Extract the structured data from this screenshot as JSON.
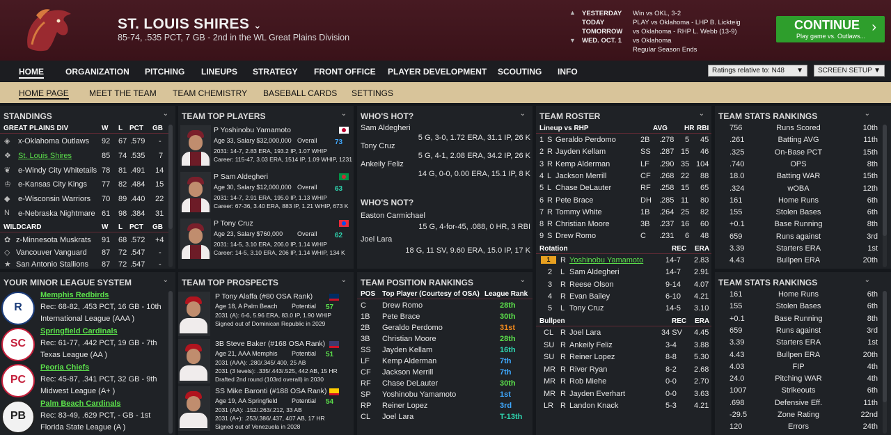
{
  "header": {
    "title": "ST. LOUIS SHIRES",
    "subtitle": "85-74, .535 PCT, 7 GB - 2nd in the WL Great Plains Division",
    "schedule": [
      {
        "day": "YESTERDAY",
        "info": "Win vs OKL, 3-2"
      },
      {
        "day": "TODAY",
        "info": "PLAY vs Oklahoma - LHP B. Lickteig"
      },
      {
        "day": "TOMORROW",
        "info": "vs Oklahoma - RHP L. Webb (13-9)"
      },
      {
        "day": "WED. OCT. 1",
        "info": "vs Oklahoma"
      },
      {
        "day": "",
        "info": "Regular Season Ends"
      }
    ],
    "continue_label": "CONTINUE",
    "continue_sub": "Play game vs. Outlaws..."
  },
  "nav": {
    "main": [
      "HOME",
      "ORGANIZATION",
      "PITCHING",
      "LINEUPS",
      "STRATEGY",
      "FRONT OFFICE",
      "PLAYER DEVELOPMENT",
      "SCOUTING",
      "INFO"
    ],
    "ratings_select": "Ratings relative to: N48",
    "screen_setup": "SCREEN SETUP",
    "sub": [
      "HOME PAGE",
      "MEET THE TEAM",
      "TEAM CHEMISTRY",
      "BASEBALL CARDS",
      "SETTINGS"
    ]
  },
  "standings": {
    "title": "STANDINGS",
    "div_header": [
      "GREAT PLAINS DIV",
      "W",
      "L",
      "PCT",
      "GB"
    ],
    "div": [
      [
        "x-Oklahoma Outlaws",
        "92",
        "67",
        ".579",
        "-"
      ],
      [
        "St. Louis Shires",
        "85",
        "74",
        ".535",
        "7"
      ],
      [
        "e-Windy City Whitetails",
        "78",
        "81",
        ".491",
        "14"
      ],
      [
        "e-Kansas City Kings",
        "77",
        "82",
        ".484",
        "15"
      ],
      [
        "e-Wisconsin Warriors",
        "70",
        "89",
        ".440",
        "22"
      ],
      [
        "e-Nebraska Nightmare",
        "61",
        "98",
        ".384",
        "31"
      ]
    ],
    "wc_header": [
      "WILDCARD",
      "W",
      "L",
      "PCT",
      "GB"
    ],
    "wc": [
      [
        "z-Minnesota Muskrats",
        "91",
        "68",
        ".572",
        "+4"
      ],
      [
        "Vancouver Vanguard",
        "87",
        "72",
        ".547",
        "-"
      ],
      [
        "San Antonio Stallions",
        "87",
        "72",
        ".547",
        "-"
      ]
    ]
  },
  "minor": {
    "title": "YOUR MINOR LEAGUE SYSTEM",
    "teams": [
      {
        "name": "Memphis Redbirds",
        "rec": "Rec: 68-82, .453 PCT, 16 GB - 10th",
        "league": "International League (AAA )"
      },
      {
        "name": "Springfield Cardinals",
        "rec": "Rec: 61-77, .442 PCT, 19 GB - 7th",
        "league": "Texas League (AA )"
      },
      {
        "name": "Peoria Chiefs",
        "rec": "Rec: 45-87, .341 PCT, 32 GB - 9th",
        "league": "Midwest League (A+ )"
      },
      {
        "name": "Palm Beach Cardinals",
        "rec": "Rec: 83-49, .629 PCT, - GB - 1st",
        "league": "Florida State League (A )"
      }
    ]
  },
  "top_players": {
    "title": "TEAM TOP PLAYERS",
    "players": [
      {
        "name": "P Yoshinobu Yamamoto",
        "info": "Age 33, Salary $32,000,000",
        "ovl_label": "Overall",
        "ovl": "73",
        "l1": "2031: 14-7, 2.83 ERA, 193.2 IP, 1.07 WHIP",
        "l2": "Career: 115-47, 3.03 ERA, 1514 IP, 1.09 WHIP, 1231"
      },
      {
        "name": "P Sam Aldegheri",
        "info": "Age 30, Salary $12,000,000",
        "ovl_label": "Overall",
        "ovl": "63",
        "l1": "2031: 14-7, 2.91 ERA, 195.0 IP, 1.13 WHIP",
        "l2": "Career: 67-36, 3.40 ERA, 883 IP, 1.21 WHIP, 673 K"
      },
      {
        "name": "P Tony Cruz",
        "info": "Age 23, Salary $760,000",
        "ovl_label": "Overall",
        "ovl": "62",
        "l1": "2031: 14-5, 3.10 ERA, 206.0 IP, 1.14 WHIP",
        "l2": "Career: 14-5, 3.10 ERA, 206 IP, 1.14 WHIP, 134 K"
      }
    ]
  },
  "prospects": {
    "title": "TEAM TOP PROSPECTS",
    "players": [
      {
        "name": "P Tony Alaffa (#80 OSA Rank)",
        "info": "Age 18, A Palm Beach",
        "pot_label": "Potential",
        "pot": "57",
        "l1": "2031 (A): 6-6, 5.96 ERA, 83.0 IP, 1.90 WHIP",
        "l2": "Signed out of Dominican Republic in 2029"
      },
      {
        "name": "3B Steve Baker (#168 OSA Rank)",
        "info": "Age 21, AAA Memphis",
        "pot_label": "Potential",
        "pot": "51",
        "l1": "2031 (AAA): .280/.345/.400, 25 AB",
        "l2": "2031 (3 levels): .335/.443/.525, 442 AB, 15 HR",
        "l3": "Drafted 2nd round (103rd overall) in 2030"
      },
      {
        "name": "SS Mike Baronti (#188 OSA Rank)",
        "info": "Age 19, AA Springfield",
        "pot_label": "Potential",
        "pot": "54",
        "l1": "2031 (AA): .152/.263/.212, 33 AB",
        "l2": "2031 (A+): .253/.386/.437, 407 AB, 17 HR",
        "l3": "Signed out of Venezuela in 2028"
      }
    ]
  },
  "hot": {
    "title": "WHO'S HOT?",
    "players": [
      {
        "name": "Sam Aldegheri",
        "line": "5 G, 3-0, 1.72 ERA, 31.1 IP, 26 K"
      },
      {
        "name": "Tony Cruz",
        "line": "5 G, 4-1, 2.08 ERA, 34.2 IP, 26 K"
      },
      {
        "name": "Ankeily Feliz",
        "line": "14 G, 0-0, 0.00 ERA, 15.1 IP, 8 K"
      }
    ],
    "not_title": "WHO'S NOT?",
    "not": [
      {
        "name": "Easton Carmichael",
        "line": "15 G, 4-for-45, .088, 0 HR, 3 RBI"
      },
      {
        "name": "Joel Lara",
        "line": "18 G, 11 SV, 9.60 ERA, 15.0 IP, 17 K"
      }
    ]
  },
  "pos_rank": {
    "title": "TEAM POSITION RANKINGS",
    "headers": [
      "POS",
      "Top Player (Courtesy of OSA)",
      "League Rank"
    ],
    "rows": [
      [
        "C",
        "Drew Romo",
        "28th"
      ],
      [
        "1B",
        "Pete Brace",
        "30th"
      ],
      [
        "2B",
        "Geraldo Perdomo",
        "31st"
      ],
      [
        "3B",
        "Christian Moore",
        "28th"
      ],
      [
        "SS",
        "Jayden Kellam",
        "16th"
      ],
      [
        "LF",
        "Kemp Alderman",
        "7th"
      ],
      [
        "CF",
        "Jackson Merrill",
        "7th"
      ],
      [
        "RF",
        "Chase DeLauter",
        "30th"
      ],
      [
        "SP",
        "Yoshinobu Yamamoto",
        "1st"
      ],
      [
        "RP",
        "Reiner Lopez",
        "3rd"
      ],
      [
        "CL",
        "Joel Lara",
        "T-13th"
      ]
    ]
  },
  "roster": {
    "title": "TEAM ROSTER",
    "lineup_header": [
      "Lineup vs RHP",
      "AVG",
      "HR",
      "RBI"
    ],
    "lineup": [
      [
        "1",
        "S",
        "Geraldo Perdomo",
        "2B",
        ".278",
        "5",
        "45"
      ],
      [
        "2",
        "R",
        "Jayden Kellam",
        "SS",
        ".287",
        "15",
        "46"
      ],
      [
        "3",
        "R",
        "Kemp Alderman",
        "LF",
        ".290",
        "35",
        "104"
      ],
      [
        "4",
        "L",
        "Jackson Merrill",
        "CF",
        ".268",
        "22",
        "88"
      ],
      [
        "5",
        "L",
        "Chase DeLauter",
        "RF",
        ".258",
        "15",
        "65"
      ],
      [
        "6",
        "R",
        "Pete Brace",
        "DH",
        ".285",
        "11",
        "80"
      ],
      [
        "7",
        "R",
        "Tommy White",
        "1B",
        ".264",
        "25",
        "82"
      ],
      [
        "8",
        "R",
        "Christian Moore",
        "3B",
        ".237",
        "16",
        "60"
      ],
      [
        "9",
        "S",
        "Drew Romo",
        "C",
        ".231",
        "6",
        "48"
      ]
    ],
    "rot_header": [
      "Rotation",
      "REC",
      "ERA"
    ],
    "rotation": [
      [
        "1",
        "R",
        "Yoshinobu Yamamoto",
        "14-7",
        "2.83"
      ],
      [
        "2",
        "L",
        "Sam Aldegheri",
        "14-7",
        "2.91"
      ],
      [
        "3",
        "R",
        "Reese Olson",
        "9-14",
        "4.07"
      ],
      [
        "4",
        "R",
        "Evan Bailey",
        "6-10",
        "4.21"
      ],
      [
        "5",
        "L",
        "Tony Cruz",
        "14-5",
        "3.10"
      ]
    ],
    "pen_header": [
      "Bullpen",
      "REC",
      "ERA"
    ],
    "bullpen": [
      [
        "CL",
        "R",
        "Joel Lara",
        "34 SV",
        "4.45"
      ],
      [
        "SU",
        "R",
        "Ankeily Feliz",
        "3-4",
        "3.88"
      ],
      [
        "SU",
        "R",
        "Reiner Lopez",
        "8-8",
        "5.30"
      ],
      [
        "MR",
        "R",
        "River Ryan",
        "8-2",
        "2.68"
      ],
      [
        "MR",
        "R",
        "Rob Miehe",
        "0-0",
        "2.70"
      ],
      [
        "MR",
        "R",
        "Jayden Everhart",
        "0-0",
        "3.63"
      ],
      [
        "LR",
        "R",
        "Landon Knack",
        "5-3",
        "4.21"
      ]
    ]
  },
  "stats1": {
    "title": "TEAM STATS RANKINGS",
    "rows": [
      [
        "756",
        "Runs Scored",
        "10th"
      ],
      [
        ".261",
        "Batting AVG",
        "11th"
      ],
      [
        ".325",
        "On-Base PCT",
        "15th"
      ],
      [
        ".740",
        "OPS",
        "8th"
      ],
      [
        "18.0",
        "Batting WAR",
        "15th"
      ],
      [
        ".324",
        "wOBA",
        "12th"
      ],
      [
        "161",
        "Home Runs",
        "6th"
      ],
      [
        "155",
        "Stolen Bases",
        "6th"
      ],
      [
        "+0.1",
        "Base Running",
        "8th"
      ],
      [
        "659",
        "Runs against",
        "3rd"
      ],
      [
        "3.39",
        "Starters ERA",
        "1st"
      ],
      [
        "4.43",
        "Bullpen ERA",
        "20th"
      ]
    ]
  },
  "stats2": {
    "title": "TEAM STATS RANKINGS",
    "rows": [
      [
        "161",
        "Home Runs",
        "6th"
      ],
      [
        "155",
        "Stolen Bases",
        "6th"
      ],
      [
        "+0.1",
        "Base Running",
        "8th"
      ],
      [
        "659",
        "Runs against",
        "3rd"
      ],
      [
        "3.39",
        "Starters ERA",
        "1st"
      ],
      [
        "4.43",
        "Bullpen ERA",
        "20th"
      ],
      [
        "4.03",
        "FIP",
        "4th"
      ],
      [
        "24.0",
        "Pitching WAR",
        "4th"
      ],
      [
        "1007",
        "Strikeouts",
        "6th"
      ],
      [
        ".698",
        "Defensive Eff.",
        "11th"
      ],
      [
        "-29.5",
        "Zone Rating",
        "22nd"
      ],
      [
        "120",
        "Errors",
        "24th"
      ]
    ]
  }
}
